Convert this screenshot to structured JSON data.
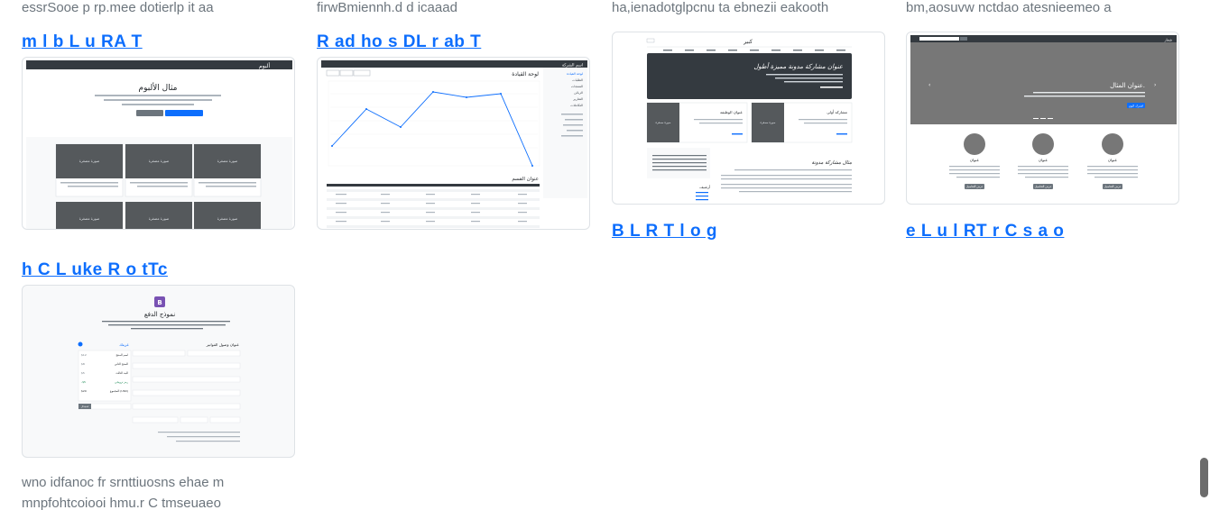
{
  "cards": [
    {
      "desc": "essrSooe p rp.mee dotierlp it aa",
      "title": "m l b L u RA T",
      "thumb_icon": "album-page-thumbnail",
      "thumb": {
        "brand": "ألبوم",
        "heading": "مثال الألبوم",
        "btn1": "الدعوة الرئيسية للعمل",
        "btn2": "عمل ثانوي",
        "tile": "صورة مصغرة"
      }
    },
    {
      "desc": "firwBmiennh.d d icaaad",
      "title": "R ad ho s DL r ab T",
      "thumb_icon": "dashboard-page-thumbnail",
      "thumb": {
        "brand": "اسم الشركة",
        "heading": "لوحة القيادة",
        "section": "عنوان القسم",
        "nav": [
          "لوحة القيادة",
          "الطلبات",
          "المنتجات",
          "الزبائن",
          "التقارير",
          "التكاملات"
        ]
      }
    },
    {
      "desc": "ha,ienadotglpcnu ta ebnezii eakooth",
      "title": "B L R T l o g",
      "thumb_icon": "blog-page-thumbnail",
      "thumb": {
        "brand": "كبير",
        "hero": "عنوان مشاركة مدونة مميزة أطول",
        "card1": "مشاركة أولى",
        "card2": "عنوان الوظيفة",
        "post": "مثال مشاركة مدونة",
        "tile": "صورة مصغرة",
        "side": "أرشيف"
      }
    },
    {
      "desc": "bm,aosuvw nctdao atesnieemeo a",
      "title": "e L u l RT r C s a o",
      "thumb_icon": "carousel-page-thumbnail",
      "thumb": {
        "brand": "شعار",
        "slide": "عنوان المثال.",
        "btn": "اشترك اليوم",
        "col": "عنوان",
        "colbtn": "عرض التفاصيل"
      }
    },
    {
      "desc": "",
      "title": "h C L uke R o tTc",
      "thumb_icon": "checkout-page-thumbnail",
      "thumb": {
        "logo": "B",
        "heading": "نموذج الدفع",
        "billing": "عنوان وصول الفواتير",
        "cart": "عربتك",
        "cart_items": [
          "اسم المنتج",
          "المنتج الثاني",
          "البند الثالث",
          "رمز ترويجي",
          "المجموع (USD)"
        ],
        "prices": [
          "$12",
          "$8",
          "$5",
          "-$5",
          "$20"
        ],
        "redeem": "استبدال"
      }
    }
  ],
  "footer_desc": [
    "wno idfanoc fr srnttiuosns ehae m",
    "mnpfohtcoiooi hmu.r C tmseuaeo"
  ]
}
